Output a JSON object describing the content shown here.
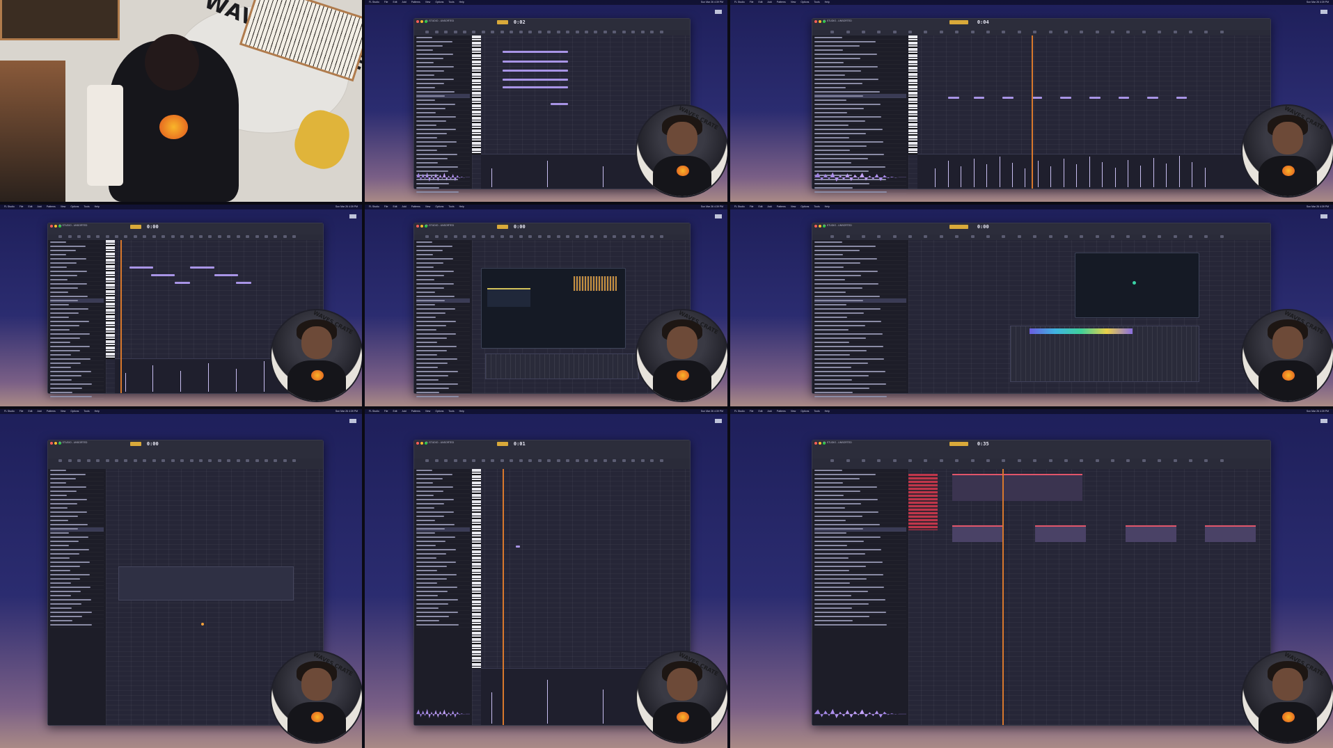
{
  "menubar": {
    "app": "FL Studio",
    "items": [
      "File",
      "Edit",
      "Add",
      "Patterns",
      "View",
      "Options",
      "Tools",
      "Help"
    ],
    "status": "Sun Mar 26  4:39 PM"
  },
  "tiles": [
    {
      "kind": "photo",
      "rug_text": "WAVES CRATE"
    },
    {
      "kind": "pianoroll",
      "time": "0:02"
    },
    {
      "kind": "pianoroll_playhead",
      "time": "0:04"
    },
    {
      "kind": "pianoroll",
      "time": "0:00"
    },
    {
      "kind": "plugin",
      "time": "0:00"
    },
    {
      "kind": "mixer",
      "time": "0:00"
    },
    {
      "kind": "playlist_empty",
      "time": "0:00"
    },
    {
      "kind": "pianoroll_sparse",
      "time": "0:01"
    },
    {
      "kind": "playlist_audio",
      "time": "0:35"
    }
  ],
  "window_title": "FL STUDIO - UNSORTED",
  "webcam_text": "WAVES CRATE",
  "colors": {
    "bg_top": "#1e1f5a",
    "note": "#a894e6",
    "playhead": "#d9782c",
    "accent": "#d9a93a"
  }
}
